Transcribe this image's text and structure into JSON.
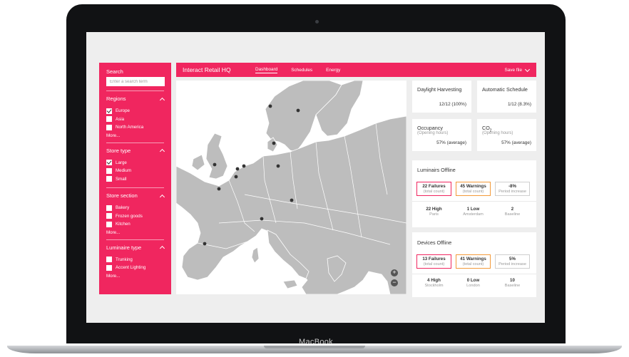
{
  "device_label": "MacBook",
  "app": {
    "title": "Interact Retail HQ",
    "tabs": [
      {
        "label": "Dashboard",
        "active": true
      },
      {
        "label": "Schedules",
        "active": false
      },
      {
        "label": "Energy",
        "active": false
      }
    ],
    "save_label": "Save file"
  },
  "sidebar": {
    "search_label": "Search",
    "search_placeholder": "Enter a search term",
    "sections": {
      "regions": {
        "title": "Regions",
        "items": [
          {
            "label": "Europe",
            "checked": true
          },
          {
            "label": "Asia",
            "checked": false
          },
          {
            "label": "North America",
            "checked": false
          }
        ],
        "more": "More..."
      },
      "store_type": {
        "title": "Store type",
        "items": [
          {
            "label": "Large",
            "checked": true
          },
          {
            "label": "Medium",
            "checked": false
          },
          {
            "label": "Small",
            "checked": false
          }
        ]
      },
      "store_section": {
        "title": "Store section",
        "items": [
          {
            "label": "Bakery",
            "checked": false
          },
          {
            "label": "Frozen goods",
            "checked": false
          },
          {
            "label": "Kitchen",
            "checked": false
          }
        ],
        "more": "More..."
      },
      "luminaire_type": {
        "title": "Luminaire type",
        "items": [
          {
            "label": "Trunking",
            "checked": false
          },
          {
            "label": "Accent Lighting",
            "checked": false
          }
        ],
        "more": "More..."
      }
    }
  },
  "cards": {
    "daylight": {
      "title": "Daylight Harvesting",
      "value": "12/12 (100%)"
    },
    "schedule": {
      "title": "Automatic Schedule",
      "value": "1/12 (8.3%)"
    },
    "occupancy": {
      "title": "Occupancy",
      "subtitle": "(Opening hours)",
      "value": "57% (average)"
    },
    "co2": {
      "title_main": "CO",
      "title_sub": "2",
      "subtitle": "(Opening hours)",
      "value": "57% (average)"
    }
  },
  "luminaires_offline": {
    "title": "Luminairs Offline",
    "stats": [
      {
        "value": "22 Failures",
        "label": "(total count)"
      },
      {
        "value": "45 Warnings",
        "label": "(total count)"
      },
      {
        "value": "-8%",
        "label": "Period increase"
      }
    ],
    "details": [
      {
        "value": "22 High",
        "label": "Paris"
      },
      {
        "value": "1 Low",
        "label": "Amsterdam"
      },
      {
        "value": "2",
        "label": "Baseline"
      }
    ]
  },
  "devices_offline": {
    "title": "Devices Offline",
    "stats": [
      {
        "value": "13 Failures",
        "label": "(total count)"
      },
      {
        "value": "41 Warnings",
        "label": "(total count)"
      },
      {
        "value": "5%",
        "label": "Period increase"
      }
    ],
    "details": [
      {
        "value": "4 High",
        "label": "Stockholm"
      },
      {
        "value": "0 Low",
        "label": "London"
      },
      {
        "value": "10",
        "label": "Baseline"
      }
    ]
  },
  "map": {
    "zoom_in": "+",
    "zoom_out": "−"
  }
}
